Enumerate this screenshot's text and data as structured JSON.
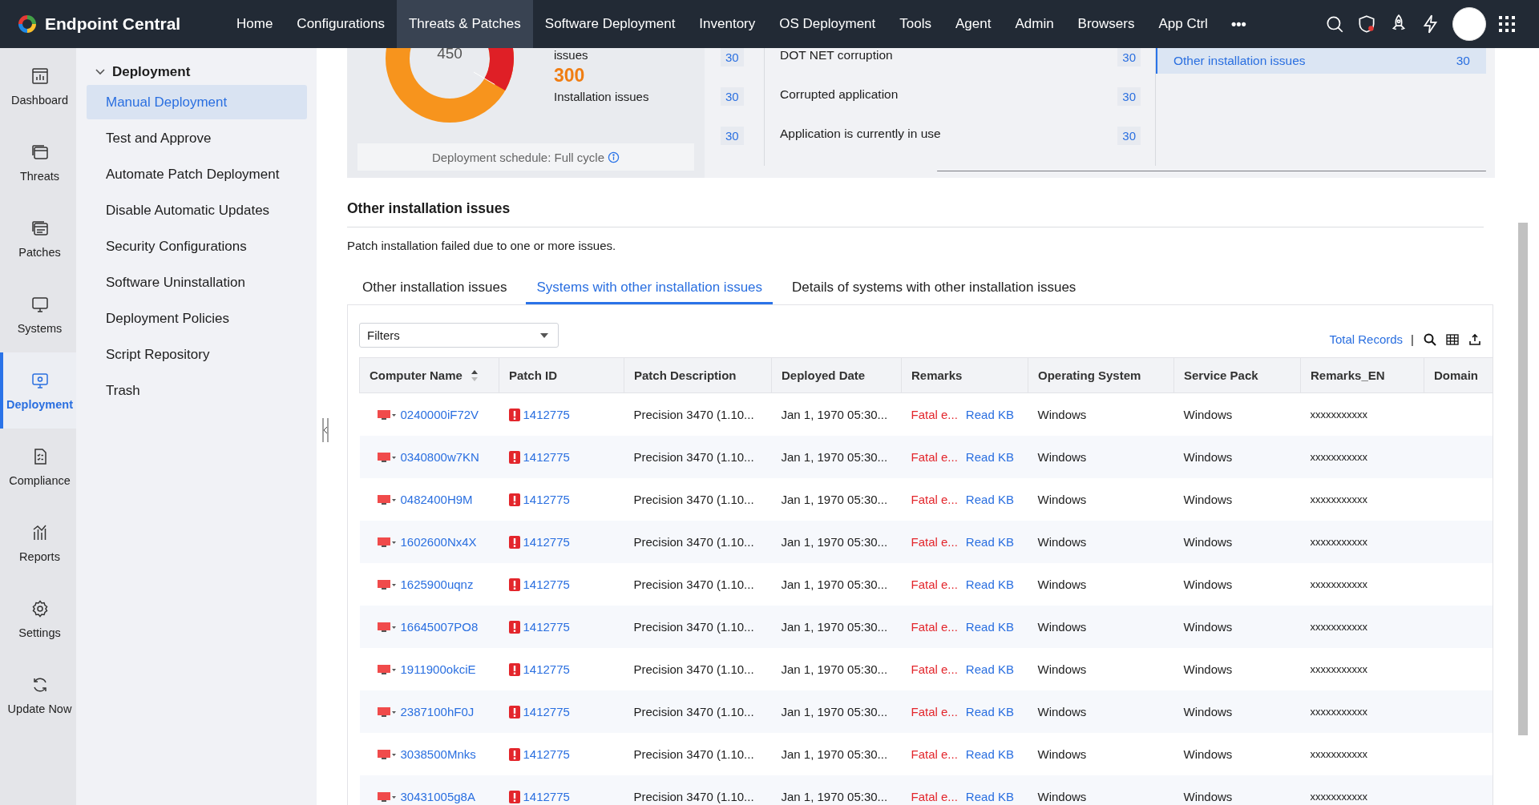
{
  "topnav": {
    "brand": "Endpoint Central",
    "items": [
      {
        "label": "Home",
        "selected": false
      },
      {
        "label": "Configurations",
        "selected": false
      },
      {
        "label": "Threats & Patches",
        "selected": true
      },
      {
        "label": "Software Deployment",
        "selected": false
      },
      {
        "label": "Inventory",
        "selected": false
      },
      {
        "label": "OS Deployment",
        "selected": false
      },
      {
        "label": "Tools",
        "selected": false
      },
      {
        "label": "Agent",
        "selected": false
      },
      {
        "label": "Admin",
        "selected": false
      },
      {
        "label": "Browsers",
        "selected": false
      },
      {
        "label": "App Ctrl",
        "selected": false
      }
    ],
    "more": "•••",
    "actions": [
      {
        "kind": "search"
      },
      {
        "kind": "shield"
      },
      {
        "kind": "rocket"
      },
      {
        "kind": "bolt"
      },
      {
        "kind": "avatar"
      },
      {
        "kind": "apps"
      }
    ]
  },
  "rail": [
    {
      "kind": "dashboard",
      "label": "Dashboard",
      "selected": false
    },
    {
      "kind": "threats",
      "label": "Threats",
      "selected": false
    },
    {
      "kind": "patches",
      "label": "Patches",
      "selected": false
    },
    {
      "kind": "systems",
      "label": "Systems",
      "selected": false
    },
    {
      "kind": "deployment",
      "label": "Deployment",
      "selected": true
    },
    {
      "kind": "compliance",
      "label": "Compliance",
      "selected": false
    },
    {
      "kind": "reports",
      "label": "Reports",
      "selected": false
    },
    {
      "kind": "settings",
      "label": "Settings",
      "selected": false
    },
    {
      "kind": "update",
      "label": "Update Now",
      "selected": false
    }
  ],
  "sidebar": {
    "heading": "Deployment",
    "expanded": true,
    "items": [
      {
        "label": "Manual Deployment",
        "selected": true
      },
      {
        "label": "Test and Approve",
        "selected": false
      },
      {
        "label": "Automate Patch Deployment",
        "selected": false
      },
      {
        "label": "Disable Automatic Updates",
        "selected": false
      },
      {
        "label": "Security Configurations",
        "selected": false
      },
      {
        "label": "Software Uninstallation",
        "selected": false
      },
      {
        "label": "Deployment Policies",
        "selected": false
      },
      {
        "label": "Script Repository",
        "selected": false
      },
      {
        "label": "Trash",
        "selected": false
      }
    ]
  },
  "summary": {
    "donut_center": "450",
    "legend": [
      {
        "label": "issues"
      },
      {
        "value": "300",
        "label": "Installation issues"
      }
    ],
    "schedule": "Deployment schedule: Full cycle"
  },
  "issue_list": {
    "rows": [
      {
        "left_count": "30",
        "label": "DOT NET corruption",
        "count": "30"
      },
      {
        "left_count": "30",
        "label": "Corrupted application",
        "count": "30"
      },
      {
        "left_count": "30",
        "label": "Application is currently in use",
        "count": "30"
      }
    ],
    "right": [
      {
        "label": "Other installation issues",
        "count": "30",
        "selected": true
      }
    ]
  },
  "section": {
    "title": "Other installation issues",
    "description": "Patch installation failed due to one or more issues."
  },
  "tabs": [
    {
      "label": "Other installation issues",
      "selected": false
    },
    {
      "label": "Systems with other installation issues",
      "selected": true
    },
    {
      "label": "Details of systems with other installation issues",
      "selected": false
    }
  ],
  "toolbar": {
    "filter": "Filters",
    "total_records": "Total Records",
    "separator": "|"
  },
  "table": {
    "columns": [
      {
        "label": "Computer Name",
        "sorted": true
      },
      {
        "label": "Patch ID",
        "sorted": false
      },
      {
        "label": "Patch Description",
        "sorted": false
      },
      {
        "label": "Deployed Date",
        "sorted": false
      },
      {
        "label": "Remarks",
        "sorted": false
      },
      {
        "label": "Operating System",
        "sorted": false
      },
      {
        "label": "Service Pack",
        "sorted": false
      },
      {
        "label": "Remarks_EN",
        "sorted": false
      },
      {
        "label": "Domain",
        "sorted": false
      }
    ],
    "rows": [
      {
        "computer": "0240000iF72V",
        "patch_id": "1412775",
        "description": "Precision 3470 (1.10...",
        "date": "Jan 1, 1970 05:30...",
        "remarks": "Fatal e...",
        "remarks_link": "Read KB",
        "os": "Windows",
        "service_pack": "Windows",
        "remarks_en": "xxxxxxxxxxx"
      },
      {
        "computer": "0340800w7KN",
        "patch_id": "1412775",
        "description": "Precision 3470 (1.10...",
        "date": "Jan 1, 1970 05:30...",
        "remarks": "Fatal e...",
        "remarks_link": "Read KB",
        "os": "Windows",
        "service_pack": "Windows",
        "remarks_en": "xxxxxxxxxxx"
      },
      {
        "computer": "0482400H9M",
        "patch_id": "1412775",
        "description": "Precision 3470 (1.10...",
        "date": "Jan 1, 1970 05:30...",
        "remarks": "Fatal e...",
        "remarks_link": "Read KB",
        "os": "Windows",
        "service_pack": "Windows",
        "remarks_en": "xxxxxxxxxxx"
      },
      {
        "computer": "1602600Nx4X",
        "patch_id": "1412775",
        "description": "Precision 3470 (1.10...",
        "date": "Jan 1, 1970 05:30...",
        "remarks": "Fatal e...",
        "remarks_link": "Read KB",
        "os": "Windows",
        "service_pack": "Windows",
        "remarks_en": "xxxxxxxxxxx"
      },
      {
        "computer": "1625900uqnz",
        "patch_id": "1412775",
        "description": "Precision 3470 (1.10...",
        "date": "Jan 1, 1970 05:30...",
        "remarks": "Fatal e...",
        "remarks_link": "Read KB",
        "os": "Windows",
        "service_pack": "Windows",
        "remarks_en": "xxxxxxxxxxx"
      },
      {
        "computer": "16645007PO8",
        "patch_id": "1412775",
        "description": "Precision 3470 (1.10...",
        "date": "Jan 1, 1970 05:30...",
        "remarks": "Fatal e...",
        "remarks_link": "Read KB",
        "os": "Windows",
        "service_pack": "Windows",
        "remarks_en": "xxxxxxxxxxx"
      },
      {
        "computer": "1911900okciE",
        "patch_id": "1412775",
        "description": "Precision 3470 (1.10...",
        "date": "Jan 1, 1970 05:30...",
        "remarks": "Fatal e...",
        "remarks_link": "Read KB",
        "os": "Windows",
        "service_pack": "Windows",
        "remarks_en": "xxxxxxxxxxx"
      },
      {
        "computer": "2387100hF0J",
        "patch_id": "1412775",
        "description": "Precision 3470 (1.10...",
        "date": "Jan 1, 1970 05:30...",
        "remarks": "Fatal e...",
        "remarks_link": "Read KB",
        "os": "Windows",
        "service_pack": "Windows",
        "remarks_en": "xxxxxxxxxxx"
      },
      {
        "computer": "3038500Mnks",
        "patch_id": "1412775",
        "description": "Precision 3470 (1.10...",
        "date": "Jan 1, 1970 05:30...",
        "remarks": "Fatal e...",
        "remarks_link": "Read KB",
        "os": "Windows",
        "service_pack": "Windows",
        "remarks_en": "xxxxxxxxxxx"
      },
      {
        "computer": "30431005g8A",
        "patch_id": "1412775",
        "description": "Precision 3470 (1.10...",
        "date": "Jan 1, 1970 05:30...",
        "remarks": "Fatal e...",
        "remarks_link": "Read KB",
        "os": "Windows",
        "service_pack": "Windows",
        "remarks_en": "xxxxxxxxxxx"
      }
    ]
  }
}
